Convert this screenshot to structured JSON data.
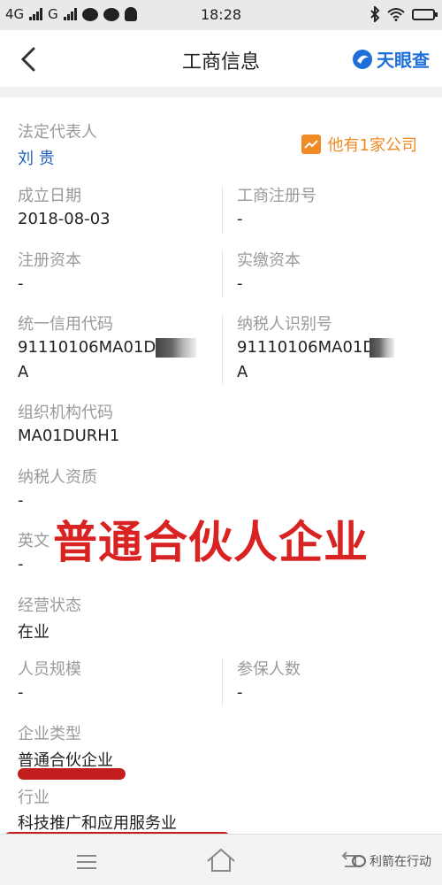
{
  "status_bar": {
    "network_1": "4G",
    "network_2": "G",
    "time": "18:28"
  },
  "header": {
    "title": "工商信息",
    "brand": "天眼查"
  },
  "legal_rep": {
    "label": "法定代表人",
    "value": "刘 贵",
    "related": "他有1家公司"
  },
  "fields": {
    "established_date": {
      "label": "成立日期",
      "value": "2018-08-03"
    },
    "reg_number": {
      "label": "工商注册号",
      "value": "-"
    },
    "reg_capital": {
      "label": "注册资本",
      "value": "-"
    },
    "paid_capital": {
      "label": "实缴资本",
      "value": "-"
    },
    "credit_code": {
      "label": "统一信用代码",
      "value_line1": "91110106MA01D",
      "value_line2": "A"
    },
    "taxpayer_id": {
      "label": "纳税人识别号",
      "value_line1": "91110106MA01D",
      "value_line2": "A"
    },
    "org_code": {
      "label": "组织机构代码",
      "value": "MA01DURH1"
    },
    "taxpayer_qual": {
      "label": "纳税人资质",
      "value": "-"
    },
    "english_name": {
      "label": "英文",
      "value": "-"
    },
    "status": {
      "label": "经营状态",
      "value": "在业"
    },
    "staff_size": {
      "label": "人员规模",
      "value": "-"
    },
    "insured": {
      "label": "参保人数",
      "value": "-"
    },
    "company_type": {
      "label": "企业类型",
      "value": "普通合伙企业"
    },
    "industry": {
      "label": "行业",
      "value": "科技推广和应用服务业"
    }
  },
  "overlay_text": "普通合伙人企业",
  "watermark": "利箭在行动",
  "colors": {
    "overlay_red": "#d92323",
    "brand_blue": "#1e6fd9",
    "related_orange": "#f08a24",
    "link_blue": "#1f5fb8"
  },
  "icons": [
    "back-arrow-icon",
    "tianyancha-logo-icon",
    "trend-chart-icon",
    "menu-icon",
    "home-icon",
    "return-icon",
    "wechat-icon"
  ]
}
